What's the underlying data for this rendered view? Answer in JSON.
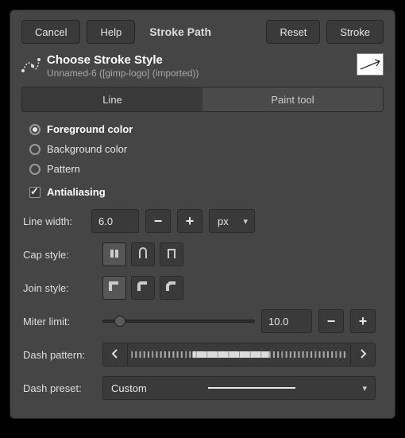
{
  "buttons": {
    "cancel": "Cancel",
    "help": "Help",
    "title": "Stroke Path",
    "reset": "Reset",
    "stroke": "Stroke"
  },
  "header": {
    "title": "Choose Stroke Style",
    "subtitle": "Unnamed-6 ([gimp-logo] (imported))"
  },
  "tabs": {
    "line": "Line",
    "paint": "Paint tool"
  },
  "source": {
    "foreground": "Foreground color",
    "background": "Background color",
    "pattern": "Pattern",
    "selected": "foreground"
  },
  "antialias": {
    "label": "Antialiasing",
    "checked": true
  },
  "line_width": {
    "label": "Line width:",
    "value": "6.0",
    "unit": "px"
  },
  "cap_style": {
    "label": "Cap style:",
    "selected": 0
  },
  "join_style": {
    "label": "Join style:",
    "selected": 0
  },
  "miter": {
    "label": "Miter limit:",
    "value": "10.0"
  },
  "dash_pattern": {
    "label": "Dash pattern:"
  },
  "dash_preset": {
    "label": "Dash preset:",
    "value": "Custom"
  },
  "chart_data": null
}
